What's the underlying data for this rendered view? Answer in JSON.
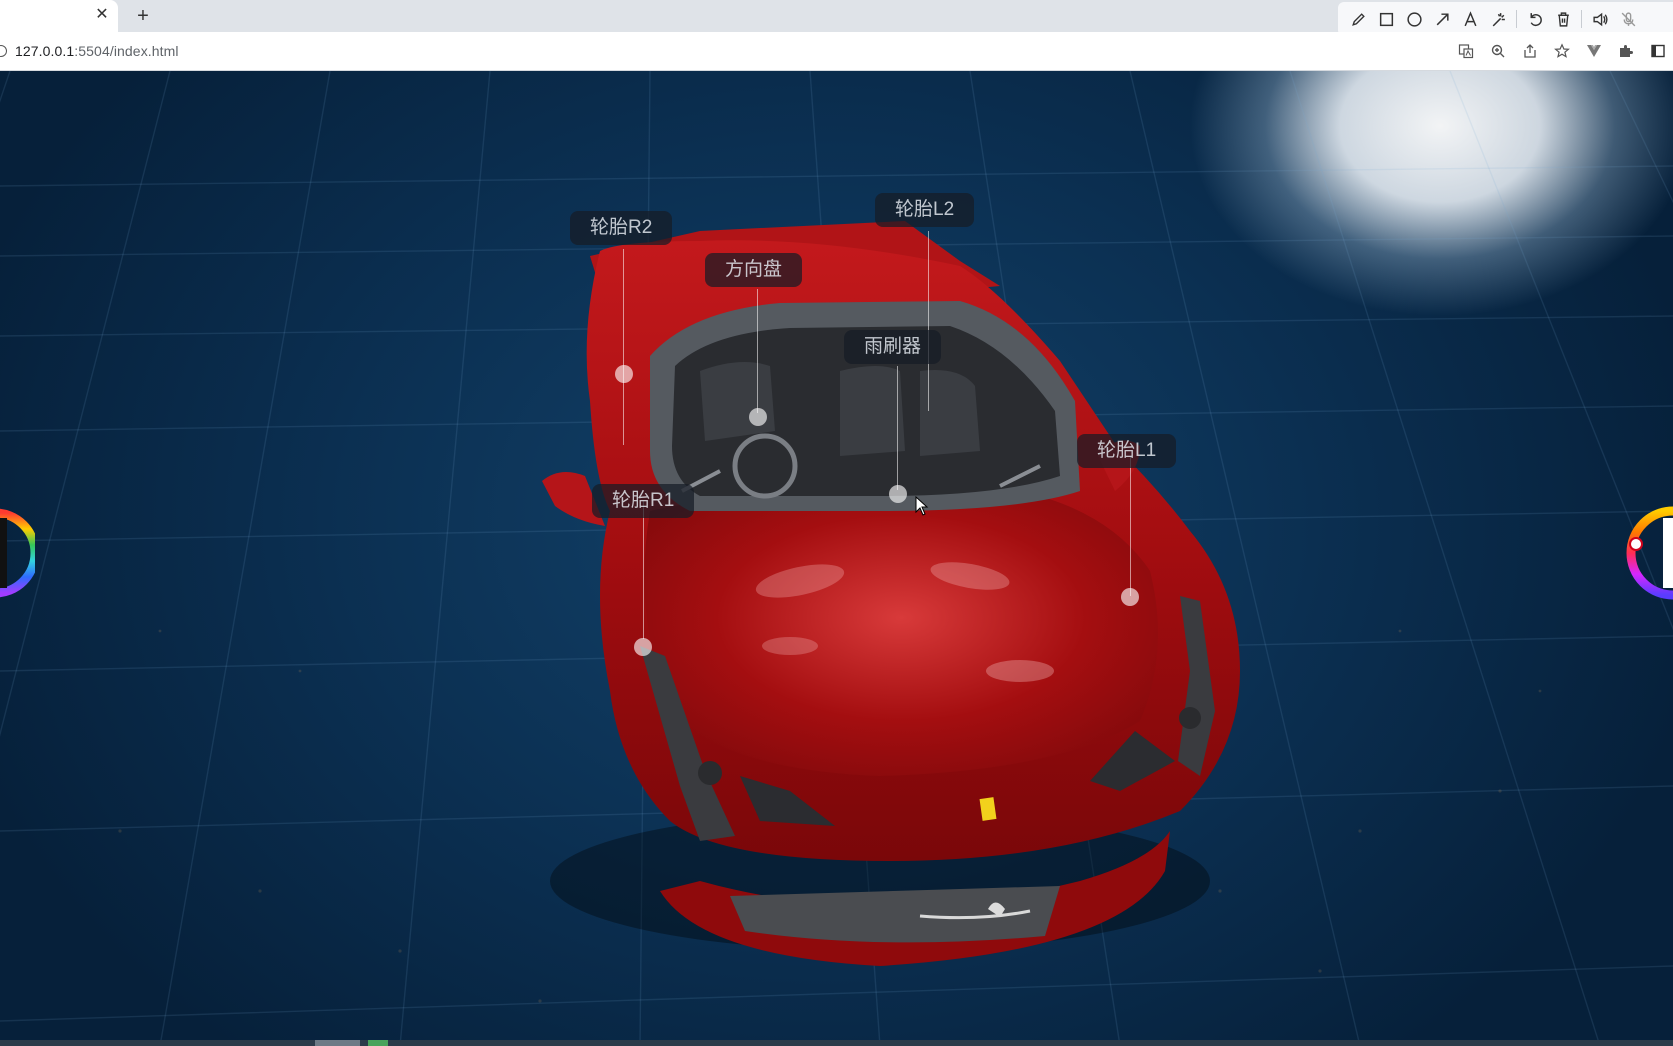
{
  "browser": {
    "tab_close_glyph": "✕",
    "new_tab_glyph": "+",
    "url_host": "127.0.0.1",
    "url_rest": ":5504/index.html",
    "annotation_tools": [
      "pencil-icon",
      "rectangle-icon",
      "circle-icon",
      "arrow-icon",
      "text-icon",
      "magic-wand-icon",
      "undo-icon",
      "trash-icon",
      "speaker-icon",
      "mic-icon"
    ],
    "address_actions": [
      "translate-icon",
      "zoom-icon",
      "share-icon",
      "star-icon",
      "vue-devtools-icon",
      "extensions-icon",
      "sidebar-icon"
    ]
  },
  "scene": {
    "car_color": "#a80d0d",
    "background_color": "#0b2f51",
    "hotspots": [
      {
        "name": "hotspot-tire-r2",
        "label": "轮胎R2"
      },
      {
        "name": "hotspot-tire-l2",
        "label": "轮胎L2"
      },
      {
        "name": "hotspot-steering-wheel",
        "label": "方向盘"
      },
      {
        "name": "hotspot-wiper",
        "label": "雨刷器"
      },
      {
        "name": "hotspot-tire-l1",
        "label": "轮胎L1"
      },
      {
        "name": "hotspot-tire-r1",
        "label": "轮胎R1"
      }
    ]
  }
}
